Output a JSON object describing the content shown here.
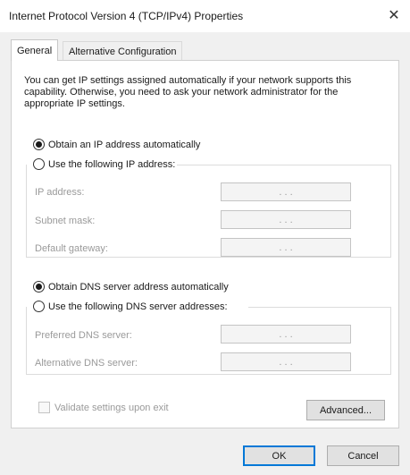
{
  "window": {
    "title": "Internet Protocol Version 4 (TCP/IPv4) Properties",
    "close_glyph": "✕"
  },
  "tabs": [
    {
      "label": "General",
      "active": true
    },
    {
      "label": "Alternative Configuration",
      "active": false
    }
  ],
  "intro_text": "You can get IP settings assigned automatically if your network supports this capability. Otherwise, you need to ask your network administrator for the appropriate IP settings.",
  "ip": {
    "auto_label": "Obtain an IP address automatically",
    "auto_selected": true,
    "manual_label": "Use the following IP address:",
    "fields": [
      {
        "label": "IP address:",
        "value": ". . ."
      },
      {
        "label": "Subnet mask:",
        "value": ". . ."
      },
      {
        "label": "Default gateway:",
        "value": ". . ."
      }
    ]
  },
  "dns": {
    "auto_label": "Obtain DNS server address automatically",
    "auto_selected": true,
    "manual_label": "Use the following DNS server addresses:",
    "fields": [
      {
        "label": "Preferred DNS server:",
        "value": ". . ."
      },
      {
        "label": "Alternative DNS server:",
        "value": ". . ."
      }
    ]
  },
  "validate_label": "Validate settings upon exit",
  "validate_checked": false,
  "buttons": {
    "advanced": "Advanced...",
    "ok": "OK",
    "cancel": "Cancel"
  },
  "colors": {
    "accent": "#0078d7",
    "disabled_text": "#9a9a9a",
    "dialog_bg": "#f0f0f0"
  }
}
